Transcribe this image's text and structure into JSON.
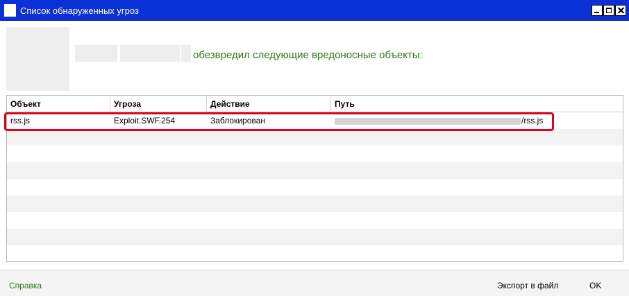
{
  "window": {
    "title": "Список обнаруженных угроз",
    "controls": [
      "minimize-icon",
      "maximize-icon",
      "close-icon"
    ]
  },
  "header": {
    "message": "обезвредил следующие вредоносные объекты:"
  },
  "table": {
    "columns": [
      "Объект",
      "Угроза",
      "Действие",
      "Путь"
    ],
    "rows": [
      {
        "object": "rss.js",
        "threat": "Exploit.SWF.254",
        "action": "Заблокирован",
        "path_suffix": "/rss.js"
      }
    ]
  },
  "footer": {
    "help_label": "Справка",
    "export_label": "Экспорт в файл",
    "ok_label": "OK"
  },
  "colors": {
    "titlebar": "#0a31d6",
    "accent_green": "#2a7a10",
    "highlight_red": "#e2001a"
  }
}
